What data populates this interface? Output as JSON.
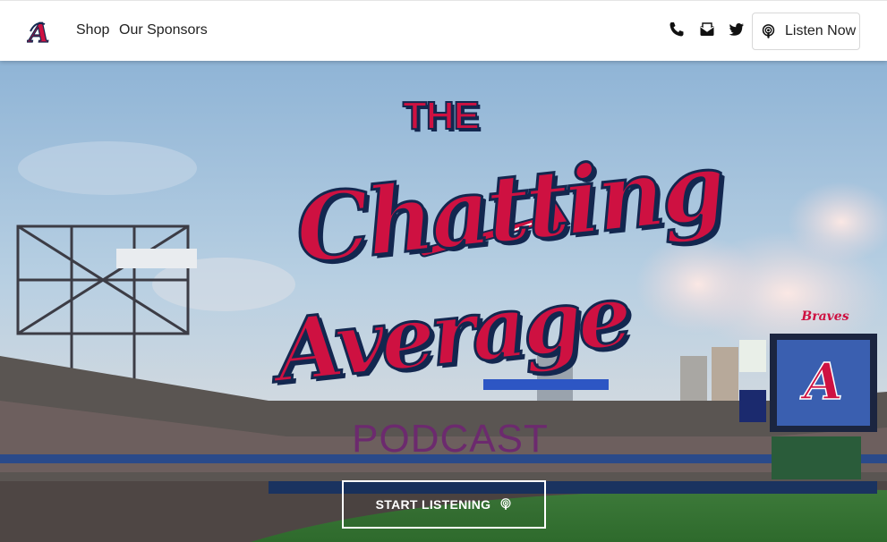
{
  "navbar": {
    "logo_icon": "atlanta-a-logo-icon",
    "links": [
      {
        "label": "Shop"
      },
      {
        "label": "Our Sponsors"
      }
    ],
    "icons": [
      "phone-icon",
      "envelope-icon",
      "twitter-icon"
    ],
    "listen_button": {
      "label": "Listen Now",
      "icon": "podcast-icon"
    }
  },
  "hero": {
    "title_line1": "THE",
    "title_line2": "Chatting",
    "title_line3": "Average",
    "title_line4": "PODCAST",
    "cta": {
      "label": "START LISTENING",
      "icon": "podcast-icon"
    }
  },
  "colors": {
    "brand_red": "#ce1141",
    "brand_navy": "#13274f",
    "podcast_purple": "#6c2a6e"
  }
}
